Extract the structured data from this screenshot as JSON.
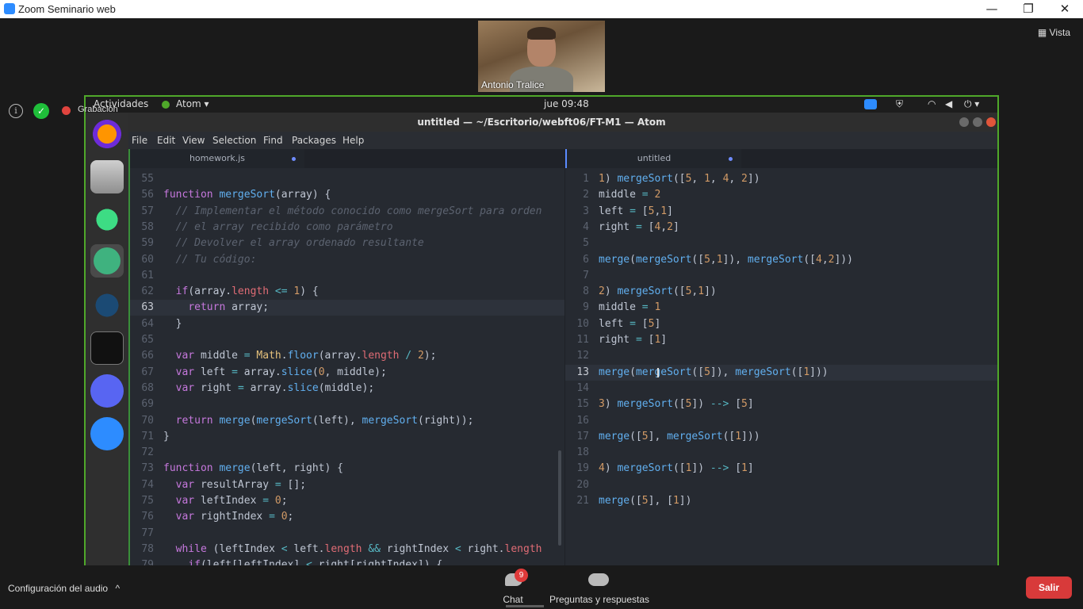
{
  "window": {
    "title": "Zoom Seminario web",
    "minimize": "—",
    "maximize": "❐",
    "close": "✕"
  },
  "meeting": {
    "view_label": "Vista",
    "participant_name": "Antonio Tralice",
    "recording_label": "Grabación"
  },
  "shared_screen": {
    "gnome_bar": {
      "activities": "Actividades",
      "app": "Atom",
      "clock": "jue 09:48"
    },
    "atom_title": "untitled — ~/Escritorio/webft06/FT-M1 — Atom",
    "menu": [
      "File",
      "Edit",
      "View",
      "Selection",
      "Find",
      "Packages",
      "Help"
    ],
    "tabs": {
      "left": "homework.js",
      "right": "untitled"
    },
    "left_lines": [
      {
        "n": "55",
        "t": ""
      },
      {
        "n": "56",
        "t": "function mergeSort(array) {"
      },
      {
        "n": "57",
        "t": "  // Implementar el método conocido como mergeSort para orden"
      },
      {
        "n": "58",
        "t": "  // el array recibido como parámetro"
      },
      {
        "n": "59",
        "t": "  // Devolver el array ordenado resultante"
      },
      {
        "n": "60",
        "t": "  // Tu código:"
      },
      {
        "n": "61",
        "t": ""
      },
      {
        "n": "62",
        "t": "  if(array.length <= 1) {"
      },
      {
        "n": "63",
        "t": "    return array;"
      },
      {
        "n": "64",
        "t": "  }"
      },
      {
        "n": "65",
        "t": ""
      },
      {
        "n": "66",
        "t": "  var middle = Math.floor(array.length / 2);"
      },
      {
        "n": "67",
        "t": "  var left = array.slice(0, middle);"
      },
      {
        "n": "68",
        "t": "  var right = array.slice(middle);"
      },
      {
        "n": "69",
        "t": ""
      },
      {
        "n": "70",
        "t": "  return merge(mergeSort(left), mergeSort(right));"
      },
      {
        "n": "71",
        "t": "}"
      },
      {
        "n": "72",
        "t": ""
      },
      {
        "n": "73",
        "t": "function merge(left, right) {"
      },
      {
        "n": "74",
        "t": "  var resultArray = [];"
      },
      {
        "n": "75",
        "t": "  var leftIndex = 0;"
      },
      {
        "n": "76",
        "t": "  var rightIndex = 0;"
      },
      {
        "n": "77",
        "t": ""
      },
      {
        "n": "78",
        "t": "  while (leftIndex < left.length && rightIndex < right.length"
      },
      {
        "n": "79",
        "t": "    if(left[leftIndex] < right[rightIndex]) {"
      }
    ],
    "right_lines": [
      {
        "n": "1",
        "t": "1) mergeSort([5, 1, 4, 2])"
      },
      {
        "n": "2",
        "t": "middle = 2"
      },
      {
        "n": "3",
        "t": "left = [5,1]"
      },
      {
        "n": "4",
        "t": "right = [4,2]"
      },
      {
        "n": "5",
        "t": ""
      },
      {
        "n": "6",
        "t": "merge(mergeSort([5,1]), mergeSort([4,2]))"
      },
      {
        "n": "7",
        "t": ""
      },
      {
        "n": "8",
        "t": "2) mergeSort([5,1])"
      },
      {
        "n": "9",
        "t": "middle = 1"
      },
      {
        "n": "10",
        "t": "left = [5]"
      },
      {
        "n": "11",
        "t": "right = [1]"
      },
      {
        "n": "12",
        "t": ""
      },
      {
        "n": "13",
        "t": "merge(mergeSort([5]), mergeSort([1]))"
      },
      {
        "n": "14",
        "t": ""
      },
      {
        "n": "15",
        "t": "3) mergeSort([5]) --> [5]"
      },
      {
        "n": "16",
        "t": ""
      },
      {
        "n": "17",
        "t": "merge([5], mergeSort([1]))"
      },
      {
        "n": "18",
        "t": ""
      },
      {
        "n": "19",
        "t": "4) mergeSort([1]) --> [1]"
      },
      {
        "n": "20",
        "t": ""
      },
      {
        "n": "21",
        "t": "merge([5], [1])"
      }
    ]
  },
  "toolbar": {
    "audio_config": "Configuración del audio",
    "audio_chevron": "^",
    "chat_label": "Chat",
    "chat_badge": "9",
    "qa_label": "Preguntas y respuestas",
    "exit_label": "Salir"
  },
  "colors": {
    "share_border": "#4fa82a",
    "exit_button": "#d83a3a",
    "accent": "#2d8cff"
  }
}
